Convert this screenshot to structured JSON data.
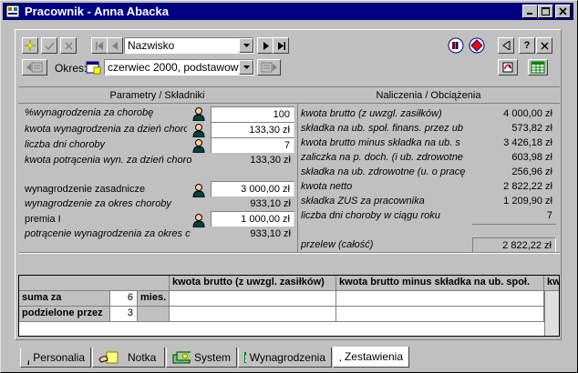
{
  "window": {
    "title": "Pracownik - Anna Abacka"
  },
  "toolbar": {
    "sort_field": "Nazwisko",
    "period_label": "Okres:",
    "period_value": "czerwiec 2000, podstawowy",
    "help": "?",
    "close": "✕"
  },
  "left": {
    "header": "Parametry / Składniki",
    "rows": [
      {
        "label": "%wynagrodzenia za chorobę",
        "value": "100"
      },
      {
        "label": "kwota wynagrodzenia za dzień choro",
        "value": "133,30 zł"
      },
      {
        "label": "liczba dni choroby",
        "value": "7"
      },
      {
        "label": "kwota potrącenia wyn. za dzień choro",
        "value": "133,30 zł"
      },
      {
        "label": "wynagrodzenie zasadnicze",
        "value": "3 000,00 zł"
      },
      {
        "label": "wynagrodzenie za okres choroby",
        "value": "933,10 zł"
      },
      {
        "label": "premia I",
        "value": "1 000,00 zł"
      },
      {
        "label": "potrącenie wynagrodzenia za okres c",
        "value": "933,10 zł"
      }
    ]
  },
  "right": {
    "header": "Naliczenia / Obciążenia",
    "rows": [
      {
        "label": "kwota brutto (z uwzgl. zasiłków)",
        "value": "4 000,00 zł"
      },
      {
        "label": "składka na ub. społ. finans. przez ub",
        "value": "573,82 zł"
      },
      {
        "label": "kwota brutto minus składka na ub. s",
        "value": "3 426,18 zł"
      },
      {
        "label": "zaliczka na p. doch. (i ub. zdrowotne",
        "value": "603,98 zł"
      },
      {
        "label": "składka na ub. zdrowotne (u. o pracę",
        "value": "256,96 zł"
      },
      {
        "label": "kwota netto",
        "value": "2 822,22 zł"
      },
      {
        "label": "składka ZUS za pracownika",
        "value": "1 209,90 zł"
      },
      {
        "label": "liczba dni choroby w ciągu roku",
        "value": "7"
      }
    ],
    "transfer_label": "przelew (całość)",
    "transfer_value": "2 822,22 zł"
  },
  "grid": {
    "columns": [
      "kwota brutto (z uwzgl. zasiłków)",
      "kwota brutto minus składka na ub. społ.",
      "kw"
    ],
    "rows": [
      {
        "label": "suma za",
        "value": "6",
        "unit": "mies."
      },
      {
        "label": "podzielone przez",
        "value": "3",
        "unit": ""
      }
    ]
  },
  "tabs": [
    {
      "label": "Personalia",
      "icon": "person-icon"
    },
    {
      "label": "Notka",
      "icon": "hand-note-icon"
    },
    {
      "label": "System",
      "icon": "money-icon"
    },
    {
      "label": "Wynagrodzenia",
      "icon": "table-icon"
    },
    {
      "label": "Zestawienia",
      "icon": "document-icon"
    }
  ],
  "colors": {
    "titlebar": "#000080",
    "face": "#c0c0c0"
  }
}
